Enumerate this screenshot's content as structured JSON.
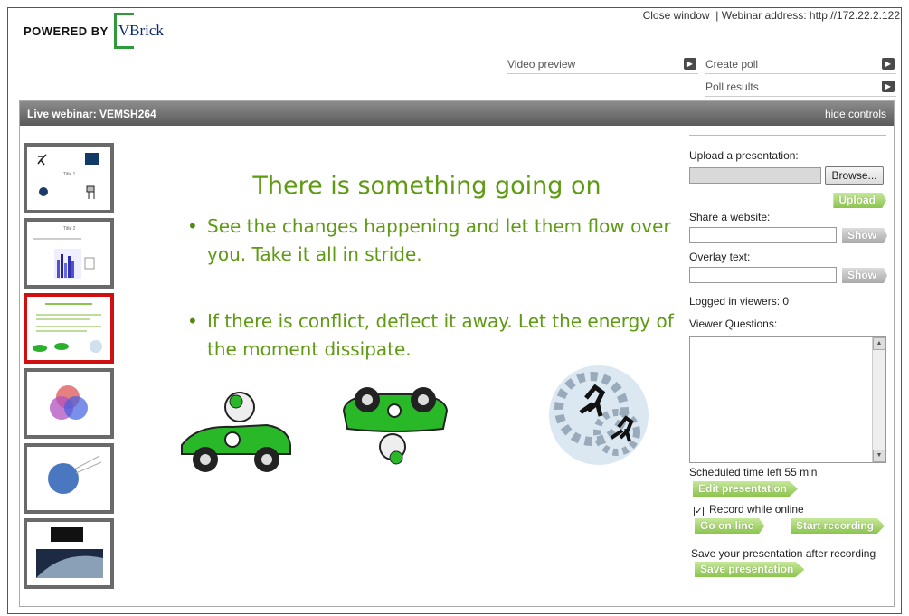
{
  "header": {
    "powered_by": "POWERED BY",
    "brand_v": "V",
    "brand_rest": "Brick",
    "close_window": "Close window",
    "separator": "|",
    "webinar_address": "Webinar address: http://172.22.2.122"
  },
  "menu": {
    "video_preview": "Video preview",
    "create_poll": "Create poll",
    "poll_results": "Poll results"
  },
  "panel": {
    "title": "Live webinar: VEMSH264",
    "hide_controls": "hide controls"
  },
  "thumbnails": [
    {
      "title": "Title 1",
      "selected": false
    },
    {
      "title": "Title 2",
      "selected": false
    },
    {
      "title": "There is something going on",
      "selected": true
    },
    {
      "title": "",
      "selected": false
    },
    {
      "title": "",
      "selected": false
    },
    {
      "title": "",
      "selected": false
    }
  ],
  "slide": {
    "title": "There is something going on",
    "bullets": [
      "See the changes happening and let them flow over you. Take it all in stride.",
      "If there is conflict, deflect it away. Let the energy of the moment dissipate."
    ]
  },
  "controls": {
    "upload_label": "Upload a presentation:",
    "browse": "Browse...",
    "upload": "Upload",
    "share_label": "Share a website:",
    "show": "Show",
    "overlay_label": "Overlay text:",
    "logged_in": "Logged in viewers: 0",
    "questions_label": "Viewer Questions:",
    "scheduled": "Scheduled time left 55 min",
    "edit_presentation": "Edit presentation",
    "record_label": "Record while online",
    "record_checked": true,
    "go_online": "Go on-line",
    "start_recording": "Start recording",
    "save_label": "Save your presentation after recording",
    "save_presentation": "Save presentation"
  },
  "colors": {
    "slide_text": "#5e9a12",
    "accent_green": "#8cc44e",
    "selected_thumb": "#d01010",
    "header_bar": "#6a6a6a"
  }
}
